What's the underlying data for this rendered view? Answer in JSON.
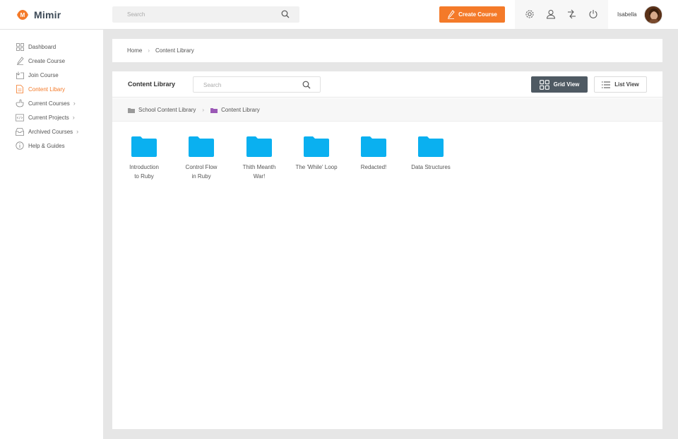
{
  "app": {
    "name": "Mimir",
    "logo_letter": "M",
    "accent": "#f47a29",
    "folder_color": "#0ab0f0"
  },
  "header": {
    "search_placeholder": "Search",
    "create_label": "Create Course",
    "icons": [
      "settings-icon",
      "user-icon",
      "switch-icon",
      "power-icon"
    ],
    "user_name": "Isabella"
  },
  "sidebar": {
    "items": [
      {
        "label": "Dashboard",
        "icon": "grid-icon",
        "active": false,
        "submenu": false
      },
      {
        "label": "Create Course",
        "icon": "pen-icon",
        "active": false,
        "submenu": false
      },
      {
        "label": "Join Course",
        "icon": "join-icon",
        "active": false,
        "submenu": false
      },
      {
        "label": "Content Libary",
        "icon": "document-icon",
        "active": true,
        "submenu": false
      },
      {
        "label": "Current Courses",
        "icon": "hand-icon",
        "active": false,
        "submenu": true
      },
      {
        "label": "Current Projects",
        "icon": "code-icon",
        "active": false,
        "submenu": true
      },
      {
        "label": "Archived Courses",
        "icon": "archive-icon",
        "active": false,
        "submenu": true
      },
      {
        "label": "Help & Guides",
        "icon": "info-icon",
        "active": false,
        "submenu": false
      }
    ]
  },
  "breadcrumb": {
    "home": "Home",
    "current": "Content Library"
  },
  "library": {
    "title": "Content Library",
    "search_placeholder": "Search",
    "grid_view_label": "Grid View",
    "list_view_label": "List View",
    "path": {
      "root": "School Content Library",
      "current": "Content Library"
    },
    "folders": [
      {
        "line1": "Introduction",
        "line2": "to Ruby"
      },
      {
        "line1": "Control Flow",
        "line2": "in Ruby"
      },
      {
        "line1": "Thith Meanth",
        "line2": "War!"
      },
      {
        "line1": "The 'While' Loop",
        "line2": ""
      },
      {
        "line1": "Redacted!",
        "line2": ""
      },
      {
        "line1": "Data Structures",
        "line2": ""
      }
    ]
  }
}
